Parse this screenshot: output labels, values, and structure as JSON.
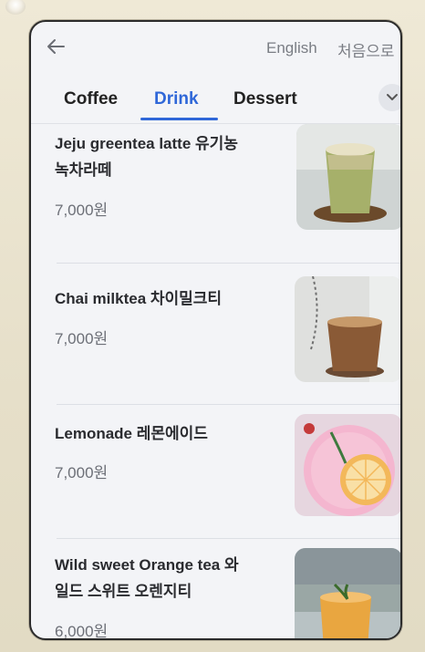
{
  "topbar": {
    "language_label": "English",
    "home_label": "처음으로"
  },
  "tabs": [
    {
      "label": "Coffee",
      "active": false
    },
    {
      "label": "Drink",
      "active": true
    },
    {
      "label": "Dessert",
      "active": false
    }
  ],
  "menu_items": [
    {
      "name_line1": "Jeju greentea latte  유기농",
      "name_line2": "녹차라떼",
      "price": "7,000원",
      "image_icon": "greentea-latte-photo"
    },
    {
      "name_line1": "Chai milktea  차이밀크티",
      "name_line2": "",
      "price": "7,000원",
      "image_icon": "chai-milktea-photo"
    },
    {
      "name_line1": "Lemonade  레몬에이드",
      "name_line2": "",
      "price": "7,000원",
      "image_icon": "lemonade-photo"
    },
    {
      "name_line1": "Wild sweet Orange tea  와",
      "name_line2": "일드 스위트 오렌지티",
      "price": "6,000원",
      "image_icon": "orange-tea-photo"
    }
  ],
  "colors": {
    "accent": "#2f67d8",
    "text": "#2a2b2f",
    "muted": "#6c6f77"
  }
}
